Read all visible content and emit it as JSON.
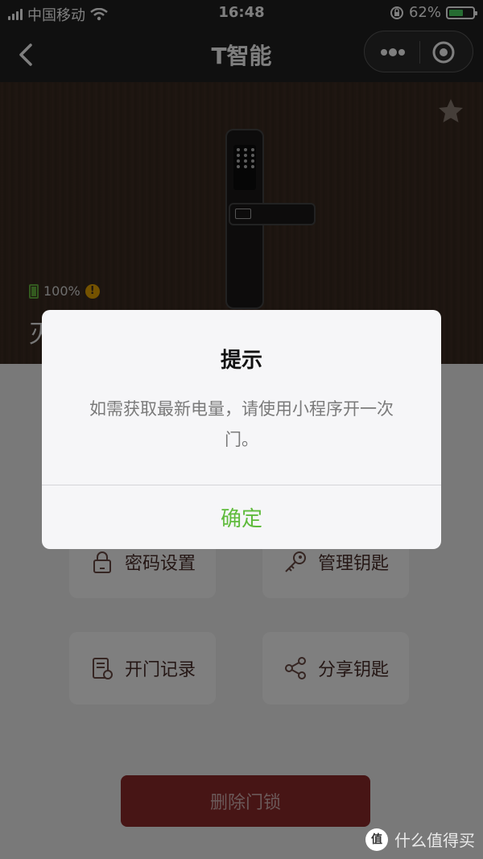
{
  "status": {
    "carrier": "中国移动",
    "time": "16:48",
    "battery_percent_text": "62%",
    "battery_level": 0.62
  },
  "nav": {
    "title": "T智能",
    "icons": {
      "back": "chevron-left-icon",
      "more": "more-dots-icon",
      "close": "target-circle-icon"
    }
  },
  "lock": {
    "battery_text": "100%",
    "name_partial": "灭",
    "favorite_icon": "star-icon"
  },
  "actions": [
    {
      "label": "密码设置",
      "icon": "lock-icon"
    },
    {
      "label": "管理钥匙",
      "icon": "key-icon"
    },
    {
      "label": "开门记录",
      "icon": "record-document-icon"
    },
    {
      "label": "分享钥匙",
      "icon": "share-icon"
    }
  ],
  "delete_button": "删除门锁",
  "dialog": {
    "title": "提示",
    "message": "如需获取最新电量，请使用小程序开一次门。",
    "confirm": "确定"
  },
  "watermark": {
    "logo": "值",
    "text": "什么值得买"
  },
  "colors": {
    "nav_bg": "#212121",
    "accent_green": "#5fbb3c",
    "delete_red": "#8f2a2a",
    "action_text": "#4a2e2a"
  }
}
